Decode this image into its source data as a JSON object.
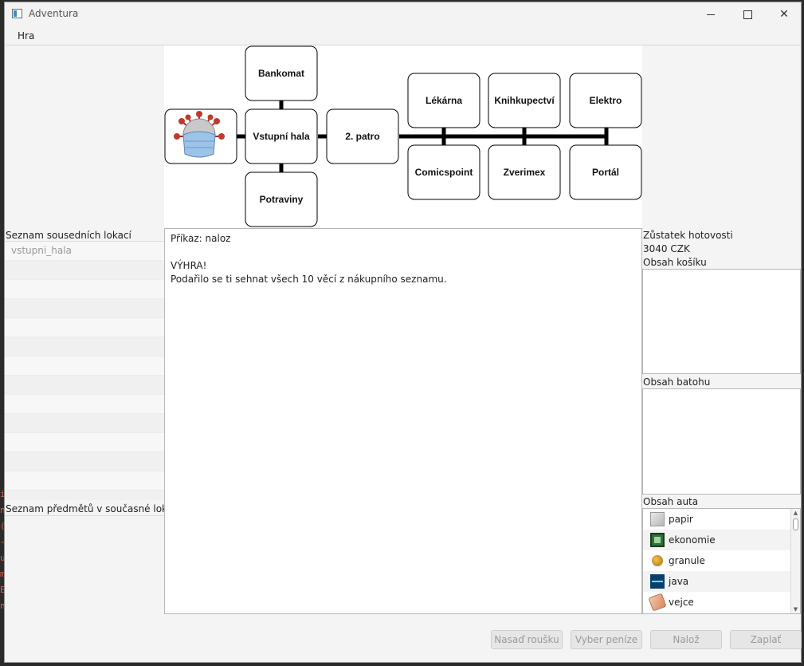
{
  "window": {
    "title": "Adventura"
  },
  "menu": {
    "items": [
      "Hra"
    ]
  },
  "map": {
    "rooms": {
      "bankomat": "Bankomat",
      "vstupni_hala": "Vstupní hala",
      "potraviny": "Potraviny",
      "patro2": "2. patro",
      "lekarna": "Lékárna",
      "knihkupectvi": "Knihkupectví",
      "elektro": "Elektro",
      "comicspoint": "Comicspoint",
      "zverimex": "Zverimex",
      "portal": "Portál"
    }
  },
  "left": {
    "neighbors_label": "Seznam sousedních lokací",
    "neighbors": [
      "vstupni_hala"
    ],
    "items_label": "Seznam předmětů v současné lokaci"
  },
  "console": {
    "lines": [
      "Příkaz: naloz",
      "",
      "VÝHRA!",
      "Podařilo se ti sehnat všech 10 věcí z nákupního seznamu."
    ]
  },
  "right": {
    "cash_label": "Zůstatek hotovosti",
    "cash_value": "3040 CZK",
    "cart_label": "Obsah košíku",
    "backpack_label": "Obsah batohu",
    "car_label": "Obsah auta",
    "car_items": [
      {
        "name": "papir",
        "icon": "paper-icon"
      },
      {
        "name": "ekonomie",
        "icon": "book-icon"
      },
      {
        "name": "granule",
        "icon": "dog-food-icon"
      },
      {
        "name": "java",
        "icon": "java-book-icon"
      },
      {
        "name": "vejce",
        "icon": "eggs-icon"
      }
    ]
  },
  "buttons": {
    "mask": "Nasaď roušku",
    "money": "Vyber peníze",
    "load": "Nalož",
    "pay": "Zaplať"
  }
}
